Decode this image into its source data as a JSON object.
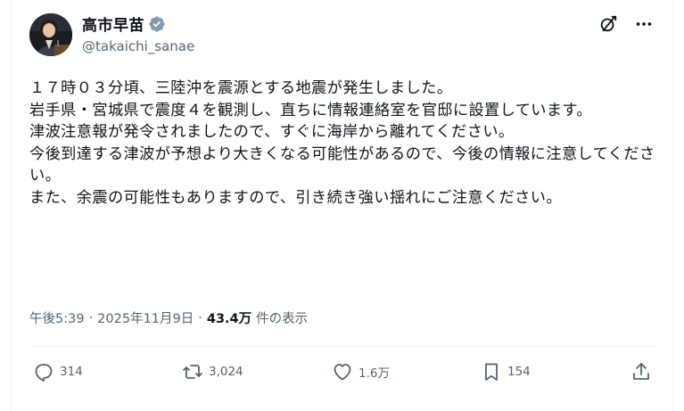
{
  "author": {
    "display_name": "高市早苗",
    "handle": "@takaichi_sanae",
    "verified": true
  },
  "post": {
    "lines": [
      "１７時０３分頃、三陸沖を震源とする地震が発生しました。",
      "岩手県・宮城県で震度４を観測し、直ちに情報連絡室を官邸に設置しています。",
      "津波注意報が発令されましたので、すぐに海岸から離れてください。",
      "今後到達する津波が予想より大きくなる可能性があるので、今後の情報に注意してください。",
      "また、余震の可能性もありますので、引き続き強い揺れにご注意ください。"
    ]
  },
  "meta": {
    "time": "午後5:39",
    "date": "2025年11月9日",
    "views_count": "43.4万",
    "views_label": "件の表示",
    "separator": "·"
  },
  "actions": {
    "replies": "314",
    "reposts": "3,024",
    "likes": "1.6万",
    "bookmarks": "154"
  },
  "icons": {
    "top_right": [
      "grok-icon",
      "more-icon"
    ],
    "action_bar": [
      "reply-icon",
      "repost-icon",
      "like-icon",
      "bookmark-icon",
      "share-icon"
    ]
  },
  "colors": {
    "text": "#0f1419",
    "secondary": "#536471",
    "verified_badge": "#829aab",
    "divider": "#eff3f4"
  }
}
